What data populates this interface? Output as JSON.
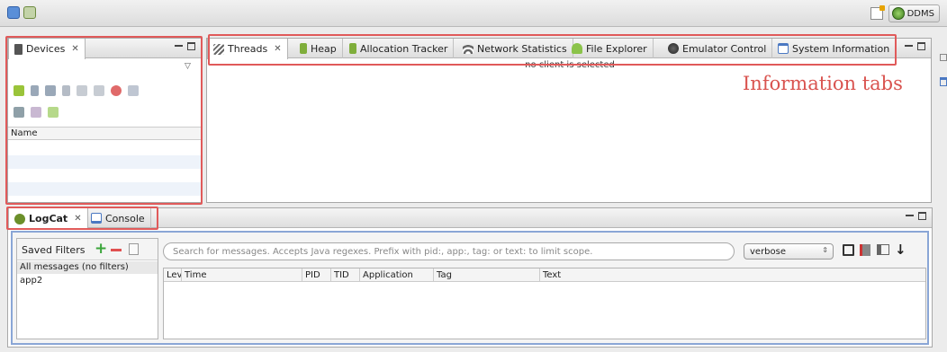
{
  "toolbar": {
    "perspective_label": "DDMS"
  },
  "devices_view": {
    "tab_label": "Devices",
    "column_header": "Name"
  },
  "info_view": {
    "tabs": [
      {
        "label": "Threads"
      },
      {
        "label": "Heap"
      },
      {
        "label": "Allocation Tracker"
      },
      {
        "label": "Network Statistics"
      },
      {
        "label": "File Explorer"
      },
      {
        "label": "Emulator Control"
      },
      {
        "label": "System Information"
      }
    ],
    "empty_message": "no client is selected",
    "annotation": "Information tabs"
  },
  "bottom_view": {
    "tabs": [
      {
        "label": "LogCat"
      },
      {
        "label": "Console"
      }
    ]
  },
  "logcat": {
    "saved_filters_label": "Saved Filters",
    "filters": [
      "All messages (no filters)",
      "app2"
    ],
    "search_placeholder": "Search for messages. Accepts Java regexes. Prefix with pid:, app:, tag: or text: to limit scope.",
    "level_value": "verbose",
    "columns": [
      "Lev",
      "Time",
      "PID",
      "TID",
      "Application",
      "Tag",
      "Text"
    ]
  },
  "colors": {
    "highlight": "#e05a5a",
    "android_green": "#8bc34a",
    "logcat_border": "#8aa6d6"
  }
}
